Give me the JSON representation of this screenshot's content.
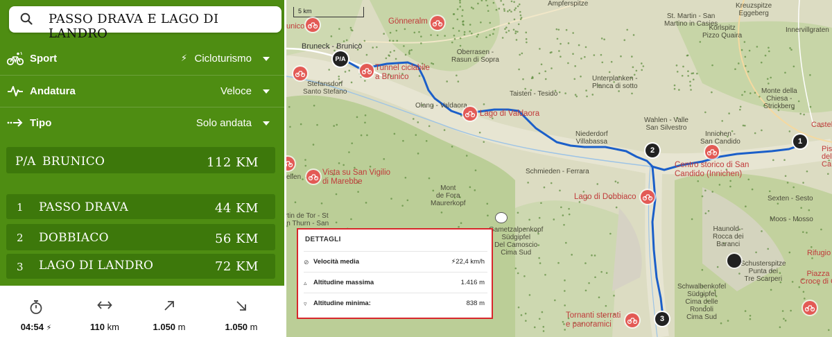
{
  "search": {
    "query": "PASSO DRAVA E LAGO DI LANDRO"
  },
  "filters": [
    {
      "label": "Sport",
      "value": "Cicloturismo",
      "icon": "bike-icon",
      "value_icon": "bolt-icon"
    },
    {
      "label": "Andatura",
      "value": "Veloce",
      "icon": "pace-icon"
    },
    {
      "label": "Tipo",
      "value": "Solo andata",
      "icon": "one-way-icon"
    }
  ],
  "route": {
    "start": {
      "code": "P/A",
      "name": "BRUNICO",
      "km": "112 KM"
    },
    "stages": [
      {
        "num": "1",
        "name": "PASSO DRAVA",
        "km": "44 KM"
      },
      {
        "num": "2",
        "name": "DOBBIACO",
        "km": "56 KM"
      },
      {
        "num": "3",
        "name": "LAGO DI LANDRO",
        "km": "72 KM"
      }
    ]
  },
  "stats": [
    {
      "icon": "stopwatch-icon",
      "value": "04:54",
      "unit": "",
      "extra": "⚡"
    },
    {
      "icon": "distance-icon",
      "value": "110",
      "unit": " km",
      "extra": ""
    },
    {
      "icon": "ascent-icon",
      "value": "1.050",
      "unit": " m",
      "extra": ""
    },
    {
      "icon": "descent-icon",
      "value": "1.050",
      "unit": " m",
      "extra": ""
    }
  ],
  "map": {
    "scale_label": "5 km",
    "route_color": "#1b5fc9",
    "poi_color": "#e35a55",
    "places": [
      "Bruneck - Brunico",
      "Stefansdorf\nSanto Stefano",
      "Oberrasen -\nRasun di Sopra",
      "Olang - Valdaora",
      "Taisten - Tesido",
      "Unterplanken -\nPlanca di sotto",
      "Niederdorf\nVillabassa",
      "Schmieden - Ferrara",
      "Innichen -\nSan Candido",
      "Wahlen - Valle\nSan Silvestro",
      "St. Martin - San\nMartino in Casies",
      "Mont\nde Fora\nMaurerkopf",
      "Gametzalpenkopf\nSüdgipfel\nDel Camoscio\nCima Sud",
      "Haunold -\nRocca dei\nBaranci",
      "Schwalbenkofel\nSüdgipfel\nCima delle\nRondoli\nCima Sud",
      "Monte della\nChiesa -\nStrickberg",
      "Kreuzspitze\nEggeberg",
      "Körlspitz\nPizzo Quaira",
      "Innervillgraten",
      "Sexten - Sesto",
      "Moos - Mosso",
      "Schusterspitze\nPunta dei\nTre Scarperi",
      "Ampferspitze",
      "Castel",
      "Pis\ndella\nCa",
      "Rifugio A",
      "Piazza\nCroce di C",
      "ellen",
      "unico",
      "rtin de Tor - St\nin Thurn - San"
    ],
    "pois": [
      {
        "name": "Gönneralm"
      },
      {
        "name": "Tunnel ciclabile\na Brunico"
      },
      {
        "name": "Lago di Valdaora"
      },
      {
        "name": "Vista su San Vigilio\ndi Marebbe"
      },
      {
        "name": "Lago di Dobbiaco"
      },
      {
        "name": "Centro storico di San\nCandido (Innichen)"
      },
      {
        "name": "Tornanti sterrati\ne panoramici"
      }
    ],
    "waypoints": [
      "P/A",
      "1",
      "2",
      "3"
    ]
  },
  "details": {
    "title": "DETTAGLI",
    "rows": [
      {
        "icon": "⊘",
        "label": "Velocità media",
        "value": "⚡22,4 km/h"
      },
      {
        "icon": "▵",
        "label": "Altitudine massima",
        "value": "1.416 m"
      },
      {
        "icon": "▿",
        "label": "Altitudine minima:",
        "value": "838 m"
      }
    ]
  }
}
